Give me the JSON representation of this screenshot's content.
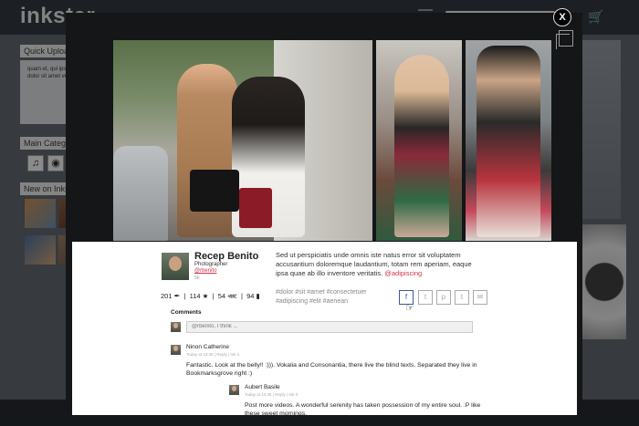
{
  "app": {
    "logo": "inkster",
    "search": {
      "placeholder": ""
    }
  },
  "sidebar": {
    "quick_upload_title": "Quick Upload",
    "quick_upload_text": "quam et, qui ipsum... dolor sit amet velit...",
    "main_categories_title": "Main Categories",
    "new_on_inkster_title": "New on Inkster shop"
  },
  "modal": {
    "close_label": "X"
  },
  "post": {
    "author_name": "Recep Benito",
    "author_role": "Photographer",
    "author_handle": "@rbenito",
    "time": "5h",
    "description": "Sed ut perspiciatis unde omnis iste natus error sit voluptatem accusantium doloremque laudantium, totam rem aperiam, eaque ipsa quae ab illo inventore veritatis.",
    "description_tag": "@adipiscing",
    "hashtags": "#dolor #sit #amet #consectetuer #adipiscing #elit #aenean",
    "stats": {
      "views": "201",
      "likes": "114",
      "shares": "54",
      "comments": "94"
    },
    "share_icons": [
      "facebook-icon",
      "twitter-icon",
      "pinterest-icon",
      "tumblr-icon",
      "email-icon"
    ]
  },
  "comments": {
    "title": "Comments",
    "input_placeholder": "@rbenito, I think ...",
    "items": [
      {
        "name": "Ninon Catherine",
        "meta": "Today at 13:30 | Reply | Ink it",
        "text": "Fantastic.  Look at the belly!! :))). Vokalia and Consonantia, there live the blind texts. Separated they live in Bookmarksgrove right :)"
      },
      {
        "name": "Aubert Basile",
        "meta": "Today at 14:35 | Reply | Ink it",
        "text": "Post more videos. A wonderful serenity has taken possession of my entire soul. :P like these sweet mornings."
      }
    ]
  }
}
